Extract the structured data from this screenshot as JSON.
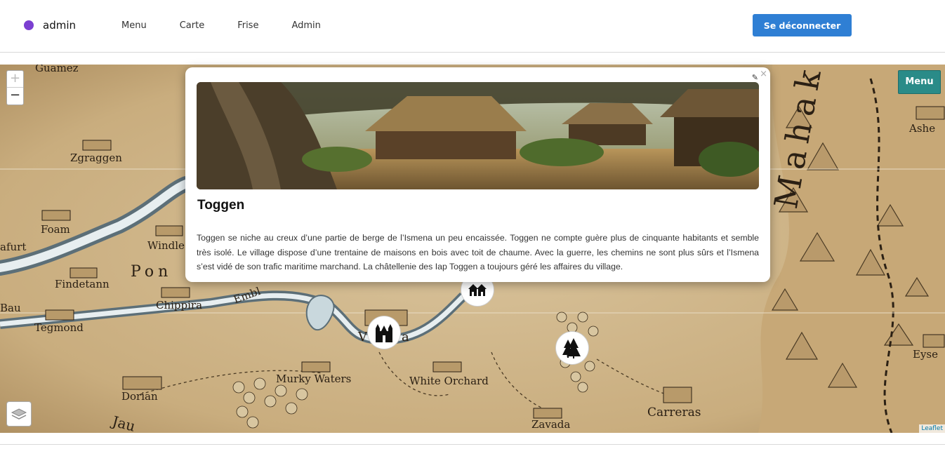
{
  "header": {
    "brand": "admin",
    "nav": [
      "Menu",
      "Carte",
      "Frise",
      "Admin"
    ],
    "logout_label": "Se déconnecter",
    "accent_color": "#2f7fd4",
    "brand_dot_color": "#7b3fd1"
  },
  "map": {
    "zoom_in": "+",
    "zoom_out": "−",
    "menu_label": "Menu",
    "attribution": "Leaflet",
    "labels": [
      "Guamez",
      "Zgraggen",
      "Foam",
      "afurt",
      "Windle",
      "Pon",
      "Findetann",
      "Chippira",
      "Embl",
      "Bau",
      "Tegmond",
      "V",
      "a",
      "Murky Waters",
      "White Orchard",
      "Dorian",
      "Jau",
      "Zavada",
      "Carreras",
      "Ashe",
      "Eyse",
      "Mahakam"
    ],
    "markers": [
      "village-marker",
      "castle-marker",
      "forest-marker"
    ]
  },
  "popup": {
    "title": "Toggen",
    "text": "Toggen se niche au creux d’une partie de berge de l’Ismena un peu encaissée. Toggen ne compte guère plus de cinquante habitants et semble très isolé. Le village dispose d’une trentaine de maisons en bois avec toit de chaume. Avec la guerre, les chemins ne sont plus sûrs et l’Ismena s’est vidé de son trafic maritime marchand. La châtellenie des Iap Toggen a toujours géré les affaires du village.",
    "close": "×",
    "edit": "✎"
  }
}
